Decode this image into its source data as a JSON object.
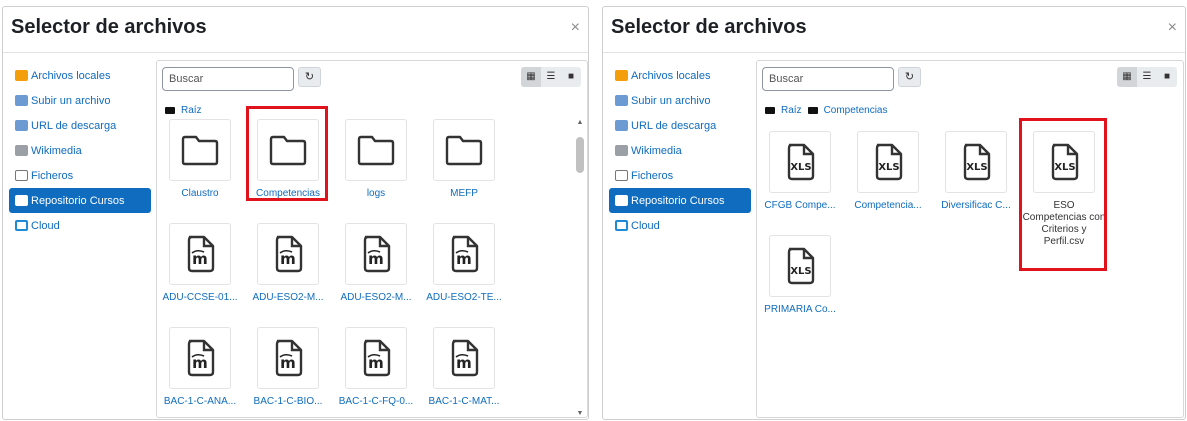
{
  "left": {
    "title": "Selector de archivos",
    "close": "×",
    "repos": [
      {
        "label": "Archivos locales",
        "color": "#f59e0b"
      },
      {
        "label": "Subir un archivo",
        "color": "#6b9bd2"
      },
      {
        "label": "URL de descarga",
        "color": "#6b9bd2"
      },
      {
        "label": "Wikimedia",
        "color": "#9aa0a6"
      },
      {
        "label": "Ficheros",
        "color": "#9aa0a6"
      },
      {
        "label": "Repositorio Cursos",
        "color": "#ffffff"
      },
      {
        "label": "Cloud",
        "color": "#1f8ad8"
      }
    ],
    "search_placeholder": "Buscar",
    "refresh": "↻",
    "views": [
      "▦",
      "☰",
      "■"
    ],
    "breadcrumb": [
      "Raíz"
    ],
    "files": [
      {
        "name": "Claustro",
        "type": "folder"
      },
      {
        "name": "Competencias",
        "type": "folder"
      },
      {
        "name": "logs",
        "type": "folder"
      },
      {
        "name": "MEFP",
        "type": "folder"
      },
      {
        "name": "ADU-CCSE-01...",
        "type": "moodle"
      },
      {
        "name": "ADU-ESO2-M...",
        "type": "moodle"
      },
      {
        "name": "ADU-ESO2-M...",
        "type": "moodle"
      },
      {
        "name": "ADU-ESO2-TE...",
        "type": "moodle"
      },
      {
        "name": "BAC-1-C-ANA...",
        "type": "moodle"
      },
      {
        "name": "BAC-1-C-BIO...",
        "type": "moodle"
      },
      {
        "name": "BAC-1-C-FQ-0...",
        "type": "moodle"
      },
      {
        "name": "BAC-1-C-MAT...",
        "type": "moodle"
      }
    ]
  },
  "right": {
    "title": "Selector de archivos",
    "close": "×",
    "repos": [
      {
        "label": "Archivos locales",
        "color": "#f59e0b"
      },
      {
        "label": "Subir un archivo",
        "color": "#6b9bd2"
      },
      {
        "label": "URL de descarga",
        "color": "#6b9bd2"
      },
      {
        "label": "Wikimedia",
        "color": "#9aa0a6"
      },
      {
        "label": "Ficheros",
        "color": "#9aa0a6"
      },
      {
        "label": "Repositorio Cursos",
        "color": "#ffffff"
      },
      {
        "label": "Cloud",
        "color": "#1f8ad8"
      }
    ],
    "search_placeholder": "Buscar",
    "refresh": "↻",
    "views": [
      "▦",
      "☰",
      "■"
    ],
    "breadcrumb": [
      "Raíz",
      "Competencias"
    ],
    "files": [
      {
        "name": "CFGB Compe...",
        "type": "xls"
      },
      {
        "name": "Competencia...",
        "type": "xls"
      },
      {
        "name": "Diversificac C...",
        "type": "xls"
      },
      {
        "name": "ESO Competencias con Criterios y Perfil.csv",
        "type": "xls"
      },
      {
        "name": "PRIMARIA Co...",
        "type": "xls"
      }
    ]
  },
  "icon_labels": {
    "xls": "XLS",
    "moodle": "m"
  },
  "colors": {
    "accent": "#0f6cbf",
    "highlight": "#e0121b"
  }
}
